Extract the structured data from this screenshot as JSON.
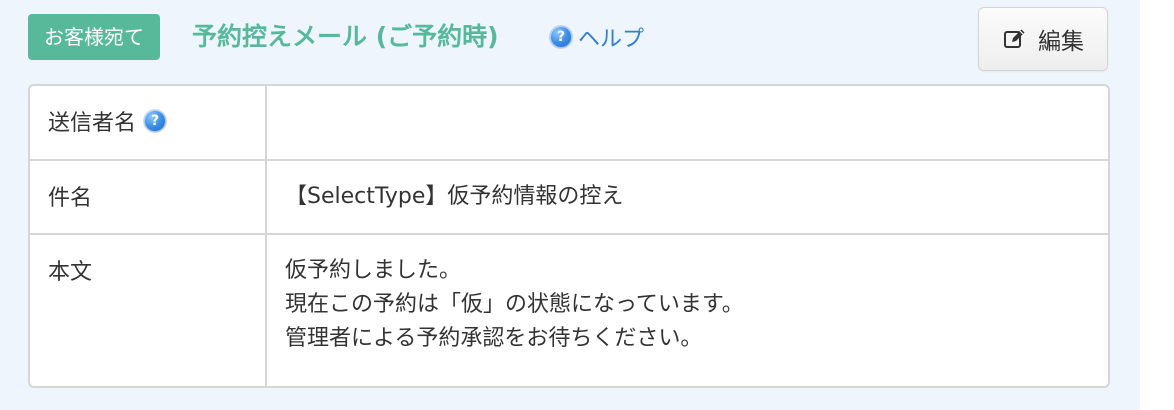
{
  "header": {
    "badge": "お客様宛て",
    "title": "予約控えメール (ご予約時)",
    "help_label": "ヘルプ",
    "help_icon": "help-icon",
    "edit_label": "編集",
    "edit_icon": "edit-icon"
  },
  "fields": {
    "sender_name_label": "送信者名",
    "sender_name_value": "",
    "sender_help_icon": "help-icon",
    "subject_label": "件名",
    "subject_value": "【SelectType】仮予約情報の控え",
    "body_label": "本文",
    "body_lines": [
      "仮予約しました。",
      "現在この予約は「仮」の状態になっています。",
      "管理者による予約承認をお待ちください。"
    ]
  },
  "colors": {
    "accent": "#58b99a",
    "link": "#2f7fd6",
    "panel_background": "#eef5fd",
    "border": "#d6d6d6",
    "text": "#333333"
  }
}
